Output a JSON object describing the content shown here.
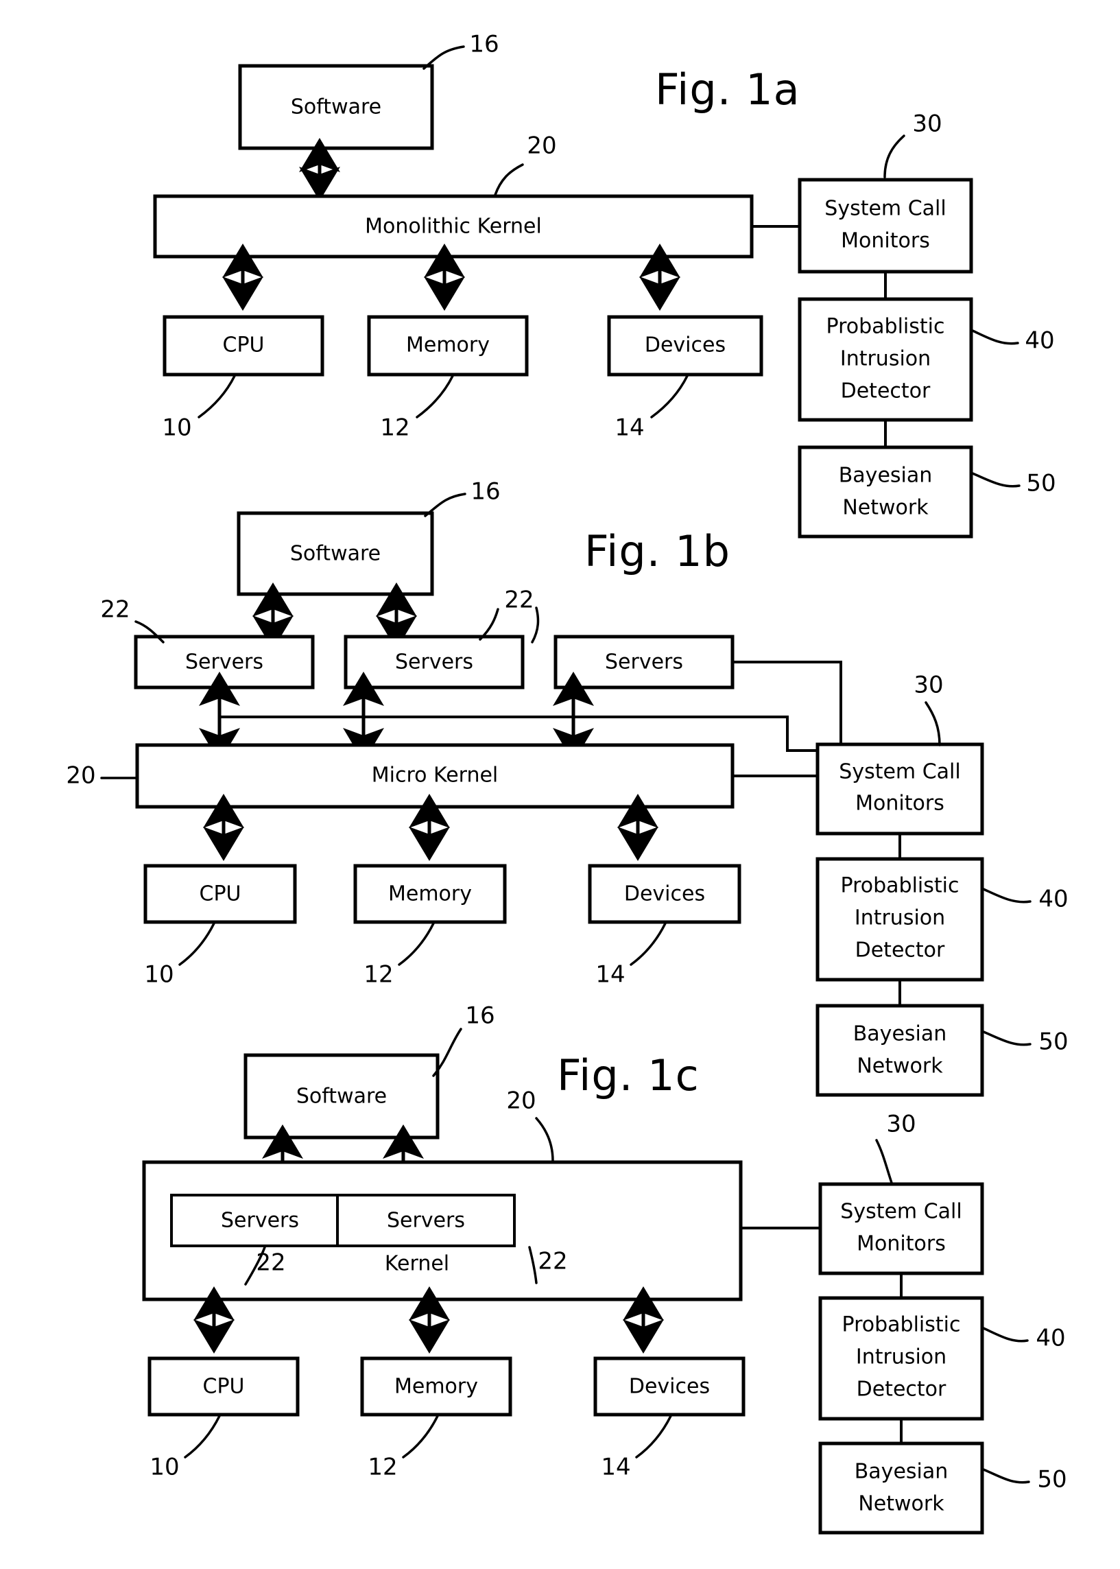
{
  "document": {
    "type": "patent-figure-sheet",
    "figures": [
      "Fig. 1a",
      "Fig. 1b",
      "Fig. 1c"
    ]
  },
  "labels": {
    "software": "Software",
    "monolithic_kernel": "Monolithic Kernel",
    "micro_kernel": "Micro Kernel",
    "kernel": "Kernel",
    "servers": "Servers",
    "cpu": "CPU",
    "memory": "Memory",
    "devices": "Devices",
    "system_call_monitors_line1": "System Call",
    "system_call_monitors_line2": "Monitors",
    "pid_line1": "Probablistic",
    "pid_line2": "Intrusion",
    "pid_line3": "Detector",
    "bayesian_line1": "Bayesian",
    "bayesian_line2": "Network"
  },
  "reference_numerals": {
    "cpu": "10",
    "memory": "12",
    "devices": "14",
    "software": "16",
    "kernel": "20",
    "servers": "22",
    "system_call_monitors": "30",
    "probablistic_intrusion_detector": "40",
    "bayesian_network": "50"
  },
  "figures": [
    {
      "id": "fig-1a",
      "title": "Fig. 1a",
      "blocks": [
        {
          "name": "software",
          "label": "Software",
          "ref": "16"
        },
        {
          "name": "monolithic-kernel",
          "label": "Monolithic Kernel",
          "ref": "20"
        },
        {
          "name": "cpu",
          "label": "CPU",
          "ref": "10"
        },
        {
          "name": "memory",
          "label": "Memory",
          "ref": "12"
        },
        {
          "name": "devices",
          "label": "Devices",
          "ref": "14"
        },
        {
          "name": "system-call-monitors",
          "label": "System Call Monitors",
          "ref": "30"
        },
        {
          "name": "probablistic-intrusion-detector",
          "label": "Probablistic Intrusion Detector",
          "ref": "40"
        },
        {
          "name": "bayesian-network",
          "label": "Bayesian Network",
          "ref": "50"
        }
      ]
    },
    {
      "id": "fig-1b",
      "title": "Fig. 1b",
      "blocks": [
        {
          "name": "software",
          "label": "Software",
          "ref": "16"
        },
        {
          "name": "servers-1",
          "label": "Servers",
          "ref": "22"
        },
        {
          "name": "servers-2",
          "label": "Servers",
          "ref": "22"
        },
        {
          "name": "servers-3",
          "label": "Servers",
          "ref": "22"
        },
        {
          "name": "micro-kernel",
          "label": "Micro Kernel",
          "ref": "20"
        },
        {
          "name": "cpu",
          "label": "CPU",
          "ref": "10"
        },
        {
          "name": "memory",
          "label": "Memory",
          "ref": "12"
        },
        {
          "name": "devices",
          "label": "Devices",
          "ref": "14"
        },
        {
          "name": "system-call-monitors",
          "label": "System Call Monitors",
          "ref": "30"
        },
        {
          "name": "probablistic-intrusion-detector",
          "label": "Probablistic Intrusion Detector",
          "ref": "40"
        },
        {
          "name": "bayesian-network",
          "label": "Bayesian Network",
          "ref": "50"
        }
      ]
    },
    {
      "id": "fig-1c",
      "title": "Fig. 1c",
      "blocks": [
        {
          "name": "software",
          "label": "Software",
          "ref": "16"
        },
        {
          "name": "kernel",
          "label": "Kernel",
          "ref": "20"
        },
        {
          "name": "servers-1",
          "label": "Servers",
          "ref": "22"
        },
        {
          "name": "servers-2",
          "label": "Servers",
          "ref": "22"
        },
        {
          "name": "cpu",
          "label": "CPU",
          "ref": "10"
        },
        {
          "name": "memory",
          "label": "Memory",
          "ref": "12"
        },
        {
          "name": "devices",
          "label": "Devices",
          "ref": "14"
        },
        {
          "name": "system-call-monitors",
          "label": "System Call Monitors",
          "ref": "30"
        },
        {
          "name": "probablistic-intrusion-detector",
          "label": "Probablistic Intrusion Detector",
          "ref": "40"
        },
        {
          "name": "bayesian-network",
          "label": "Bayesian Network",
          "ref": "50"
        }
      ]
    }
  ],
  "colors": {
    "ink": "#000000",
    "paper": "#ffffff"
  }
}
